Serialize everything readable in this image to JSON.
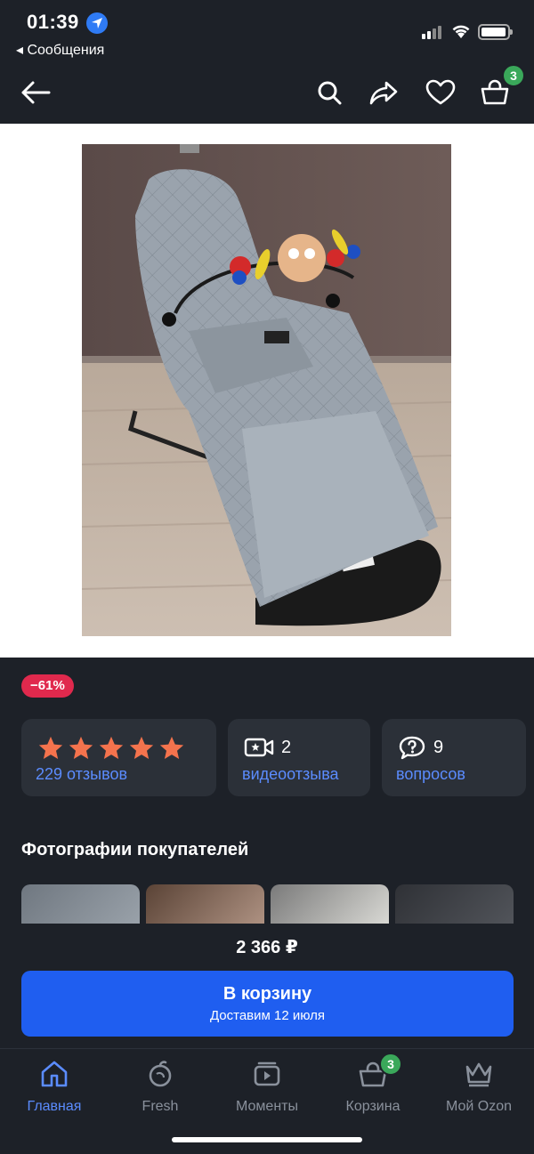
{
  "status_bar": {
    "time": "01:39",
    "back_app": "◂ Сообщения"
  },
  "header": {
    "cart_count": "3"
  },
  "product": {
    "discount": "−61%",
    "price": "2 366 ₽",
    "image_alt": "Детский шезлонг"
  },
  "stats": {
    "rating_stars": 5,
    "reviews_label": "229 отзывов",
    "video_count": "2",
    "video_label": "видеоотзыва",
    "questions_count": "9",
    "questions_label": "вопросов"
  },
  "customer_photos": {
    "title": "Фотографии покупателей"
  },
  "cta": {
    "label": "В корзину",
    "sub": "Доставим 12 июля"
  },
  "tabs": [
    {
      "label": "Главная",
      "active": true
    },
    {
      "label": "Fresh"
    },
    {
      "label": "Моменты"
    },
    {
      "label": "Корзина",
      "badge": "3"
    },
    {
      "label": "Мой Ozon"
    }
  ],
  "colors": {
    "accent": "#1f5ef0",
    "link": "#5b8cff",
    "discount": "#e0294d",
    "star": "#f4734d",
    "badge": "#3aa85a"
  }
}
